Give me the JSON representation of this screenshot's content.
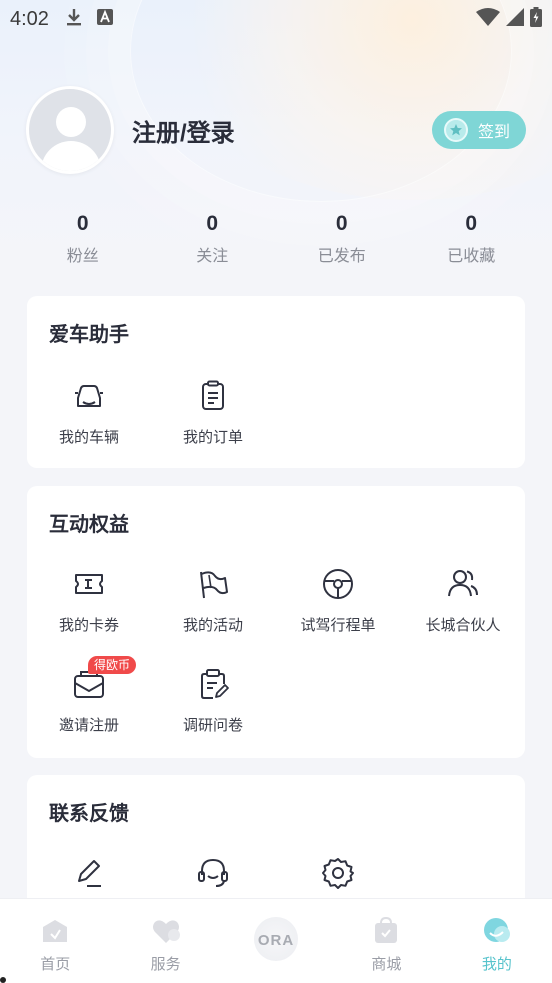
{
  "status_bar": {
    "time": "4:02"
  },
  "profile": {
    "title": "注册/登录",
    "checkin_label": "签到"
  },
  "stats": [
    {
      "value": "0",
      "label": "粉丝"
    },
    {
      "value": "0",
      "label": "关注"
    },
    {
      "value": "0",
      "label": "已发布"
    },
    {
      "value": "0",
      "label": "已收藏"
    }
  ],
  "car_assistant": {
    "title": "爱车助手",
    "items": [
      {
        "label": "我的车辆",
        "icon": "car-icon"
      },
      {
        "label": "我的订单",
        "icon": "order-list-icon"
      }
    ]
  },
  "benefits": {
    "title": "互动权益",
    "items": [
      {
        "label": "我的卡券",
        "icon": "coupon-icon"
      },
      {
        "label": "我的活动",
        "icon": "flag-icon"
      },
      {
        "label": "试驾行程单",
        "icon": "steering-wheel-icon"
      },
      {
        "label": "长城合伙人",
        "icon": "partner-icon"
      },
      {
        "label": "邀请注册",
        "icon": "invite-mail-icon",
        "badge": "得欧币"
      },
      {
        "label": "调研问卷",
        "icon": "survey-clipboard-icon"
      }
    ]
  },
  "feedback": {
    "title": "联系反馈",
    "items": [
      {
        "icon": "edit-icon"
      },
      {
        "icon": "headset-icon"
      },
      {
        "icon": "settings-gear-icon"
      }
    ]
  },
  "bottom_nav": {
    "items": [
      {
        "label": "首页",
        "icon": "home-icon"
      },
      {
        "label": "服务",
        "icon": "service-heart-icon"
      },
      {
        "label": "ORA",
        "icon": "ora-logo"
      },
      {
        "label": "商城",
        "icon": "mall-bag-icon"
      },
      {
        "label": "我的",
        "icon": "mine-icon",
        "active": true
      }
    ],
    "active_color": "#57c3cc"
  },
  "colors": {
    "accent": "#7fd6d6",
    "badge": "#f04a4a",
    "title": "#2a2d3a"
  }
}
